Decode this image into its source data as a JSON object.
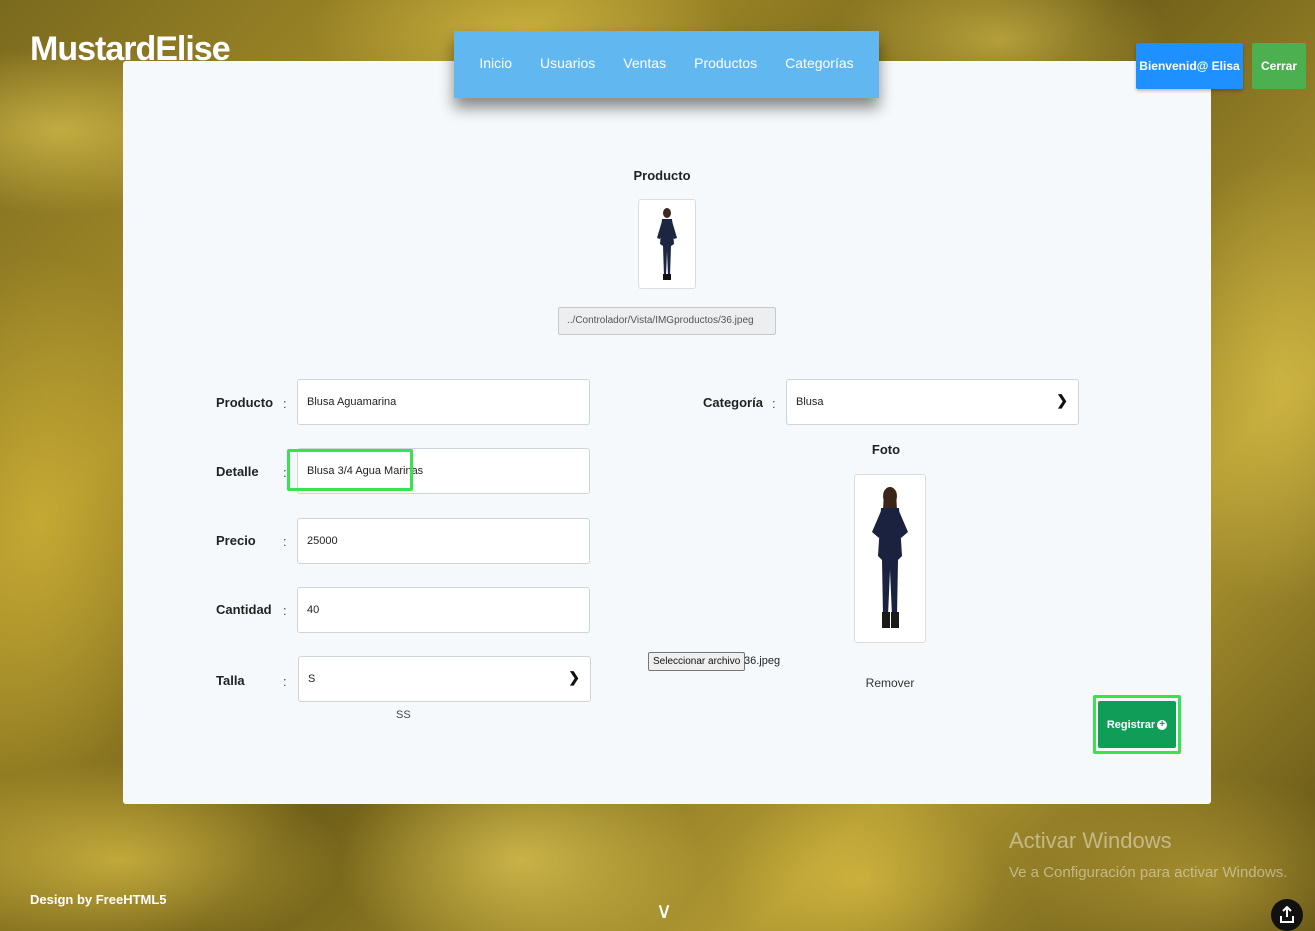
{
  "brand": {
    "logo": "MustardElise"
  },
  "nav": {
    "items": [
      "Inicio",
      "Usuarios",
      "Ventas",
      "Productos",
      "Categorías"
    ]
  },
  "header": {
    "welcome_label": "Bienvenid@ Elisa",
    "close_label": "Cerrar"
  },
  "product_preview": {
    "title": "Producto",
    "path_value": "../Controlador/Vista/IMGproductos/36.jpeg"
  },
  "form": {
    "colon": ":",
    "producto": {
      "label": "Producto",
      "value": "Blusa Aguamarina"
    },
    "detalle": {
      "label": "Detalle",
      "value": "Blusa 3/4 Agua Marinas"
    },
    "precio": {
      "label": "Precio",
      "value": "25000"
    },
    "cantidad": {
      "label": "Cantidad",
      "value": "40"
    },
    "talla": {
      "label": "Talla",
      "selected": "S",
      "hint": "SS"
    },
    "categoria": {
      "label": "Categoría",
      "selected": "Blusa"
    }
  },
  "photo": {
    "label": "Foto",
    "file_button": "Seleccionar archivo",
    "file_name": "36.jpeg",
    "remove_label": "Remover"
  },
  "actions": {
    "register_label": "Registrar"
  },
  "watermark": {
    "title": "Activar Windows",
    "subtitle": "Ve a Configuración para activar Windows."
  },
  "footer": {
    "credit": "Design by FreeHTML5"
  },
  "colors": {
    "nav_bg": "#61b7f0",
    "welcome_bg": "#1e90ff",
    "close_bg": "#4caf50",
    "register_bg": "#0f9d58",
    "highlight": "#39e24f"
  },
  "icons": {
    "select_chevron": "chevron-down-icon",
    "register": "plus-circle-icon",
    "scroll": "chevron-down-icon",
    "upload": "upload-icon"
  }
}
